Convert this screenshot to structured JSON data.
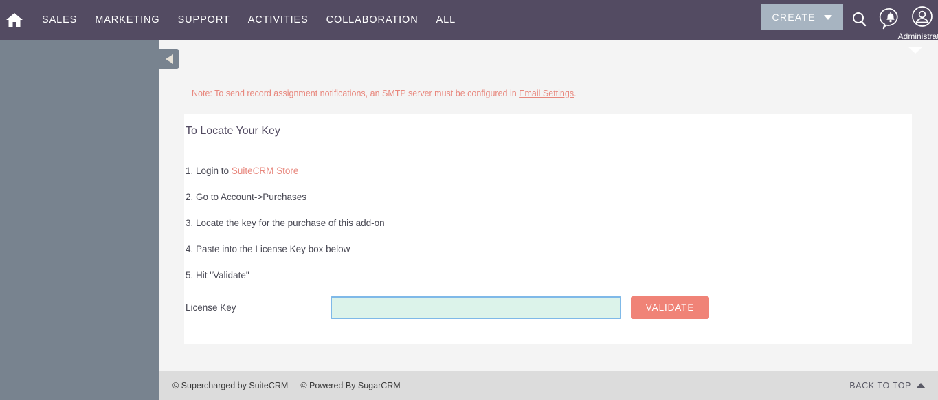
{
  "navbar": {
    "home_icon": "home-icon",
    "items": [
      {
        "label": "SALES"
      },
      {
        "label": "MARKETING"
      },
      {
        "label": "SUPPORT"
      },
      {
        "label": "ACTIVITIES"
      },
      {
        "label": "COLLABORATION"
      },
      {
        "label": "ALL"
      }
    ],
    "create_label": "CREATE",
    "search_icon": "search-icon",
    "notification_icon": "notification-bell-icon",
    "user_icon": "user-avatar-icon",
    "user_name": "Administrator",
    "background_color": "#534b62",
    "create_button_color": "#a7b4c1"
  },
  "sidebar": {
    "collapse_icon": "collapse-left-arrow-icon",
    "background_color": "#78838f"
  },
  "main": {
    "expand_icon": "chevron-down-icon",
    "note": {
      "text_before": "Note: To send record assignment notifications, an SMTP server must be configured in ",
      "link_label": "Email Settings",
      "text_after": ".",
      "color": "#e8877d"
    },
    "panel": {
      "title": "To Locate Your Key",
      "steps": [
        {
          "prefix": "1. Login to ",
          "link_label": "SuiteCRM Store",
          "suffix": ""
        },
        {
          "prefix": "2. Go to Account->Purchases",
          "link_label": "",
          "suffix": ""
        },
        {
          "prefix": "3. Locate the key for the purchase of this add-on",
          "link_label": "",
          "suffix": ""
        },
        {
          "prefix": "4. Paste into the License Key box below",
          "link_label": "",
          "suffix": ""
        },
        {
          "prefix": "5. Hit \"Validate\"",
          "link_label": "",
          "suffix": ""
        }
      ],
      "license_key_label": "License Key",
      "license_key_value": "",
      "license_key_placeholder": "",
      "validate_label": "VALIDATE",
      "validate_button_color": "#f08377",
      "input_background_color": "#dcf3ea",
      "input_border_color": "#7fb9e8"
    }
  },
  "footer": {
    "supercharged": "© Supercharged by SuiteCRM",
    "powered": "© Powered By SugarCRM",
    "back_to_top": "BACK TO TOP",
    "back_to_top_icon": "triangle-up-icon",
    "background_color": "#dcdcdc"
  }
}
